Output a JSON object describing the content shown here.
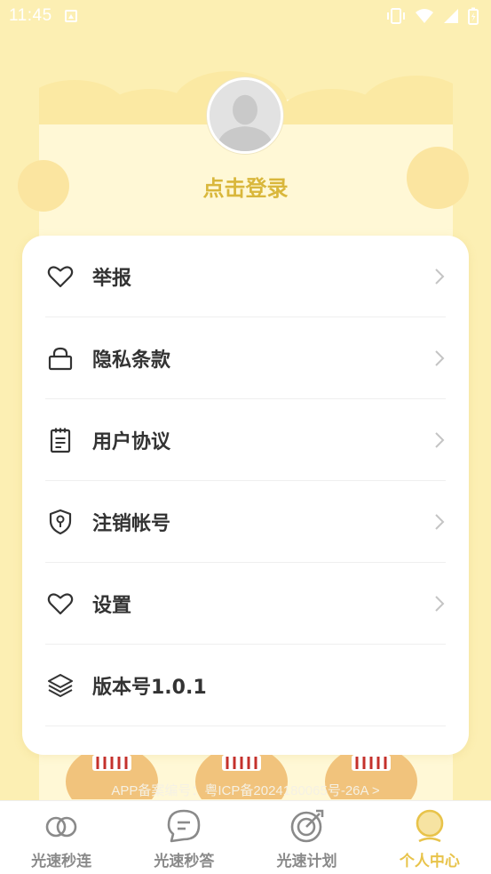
{
  "status_bar": {
    "time": "11:45"
  },
  "profile": {
    "login_label": "点击登录"
  },
  "menu": {
    "items": [
      {
        "label": "举报",
        "icon": "heart-icon",
        "has_chevron": true
      },
      {
        "label": "隐私条款",
        "icon": "lock-icon",
        "has_chevron": true
      },
      {
        "label": "用户协议",
        "icon": "clipboard-icon",
        "has_chevron": true
      },
      {
        "label": "注销帐号",
        "icon": "shield-key-icon",
        "has_chevron": true
      },
      {
        "label": "设置",
        "icon": "heart-icon",
        "has_chevron": true
      },
      {
        "label": "版本号1.0.1",
        "icon": "layers-icon",
        "has_chevron": false
      }
    ]
  },
  "footer": {
    "beian": "APP备案编号：粤ICP备2024180065号-26A >"
  },
  "tab_bar": {
    "tabs": [
      {
        "label": "光速秒连",
        "icon": "link-rings-icon",
        "active": false
      },
      {
        "label": "光速秒答",
        "icon": "chat-bubble-icon",
        "active": false
      },
      {
        "label": "光速计划",
        "icon": "target-icon",
        "active": false
      },
      {
        "label": "个人中心",
        "icon": "profile-icon",
        "active": true
      }
    ]
  },
  "colors": {
    "accent": "#d9b73b",
    "tab_active": "#e8c34a",
    "background": "#fcefb3"
  }
}
